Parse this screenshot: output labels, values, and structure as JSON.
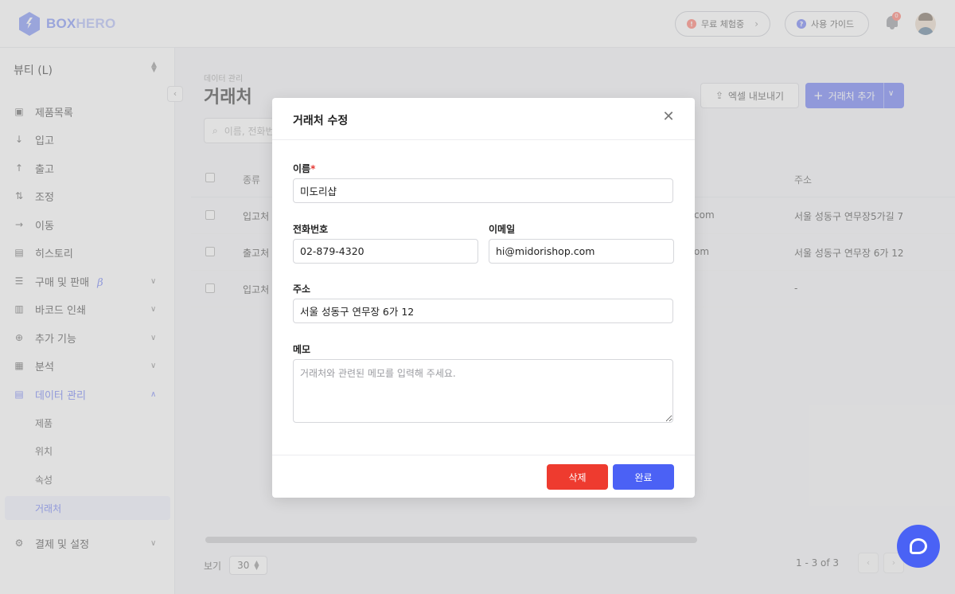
{
  "header": {
    "logo_text": "BOX",
    "logo_text_accent": "HERO",
    "trial_label": "무료 체험중",
    "trial_icon": "!",
    "guide_label": "사용 가이드",
    "guide_icon": "?",
    "notification_count": "0"
  },
  "sidebar": {
    "workspace": "뷰티 (L)",
    "items": [
      {
        "label": "제품목록",
        "icon": "box-icon"
      },
      {
        "label": "입고",
        "icon": "arrow-down-icon"
      },
      {
        "label": "출고",
        "icon": "arrow-up-icon"
      },
      {
        "label": "조정",
        "icon": "adjust-icon"
      },
      {
        "label": "이동",
        "icon": "arrow-right-icon"
      },
      {
        "label": "히스토리",
        "icon": "history-icon"
      },
      {
        "label": "구매 및 판매",
        "icon": "document-icon",
        "beta": "β"
      },
      {
        "label": "바코드 인쇄",
        "icon": "barcode-icon"
      },
      {
        "label": "추가 기능",
        "icon": "plus-circle-icon"
      },
      {
        "label": "분석",
        "icon": "chart-icon"
      },
      {
        "label": "데이터 관리",
        "icon": "database-icon"
      }
    ],
    "sub_items": [
      "제품",
      "위치",
      "속성",
      "거래처"
    ],
    "billing": "결제 및 설정"
  },
  "main": {
    "breadcrumb": "데이터 관리",
    "title": "거래처",
    "export_label": "엑셀 내보내기",
    "add_label": "거래처 추가",
    "search_placeholder": "이름, 전화번",
    "columns": {
      "type": "종류",
      "address": "주소"
    },
    "rows": [
      {
        "type": "입고처",
        "email_tail": "com",
        "address": "서울 성동구 연무장5가길 7"
      },
      {
        "type": "출고처",
        "email_tail": "om",
        "address": "서울 성동구 연무장 6가 12"
      },
      {
        "type": "입고처",
        "email_tail": "",
        "address": "-"
      }
    ],
    "view_label": "보기",
    "per_page": "30",
    "range": "1 - 3 of 3"
  },
  "modal": {
    "title": "거래처 수정",
    "name_label": "이름",
    "name_required": "*",
    "name_value": "미도리샵",
    "phone_label": "전화번호",
    "phone_value": "02-879-4320",
    "email_label": "이메일",
    "email_value": "hi@midorishop.com",
    "address_label": "주소",
    "address_value": "서울 성동구 연무장 6가 12",
    "memo_label": "메모",
    "memo_placeholder": "거래처와 관련된 메모를 입력해 주세요.",
    "delete_label": "삭제",
    "done_label": "완료"
  },
  "colors": {
    "accent": "#5b6ef5",
    "danger": "#ee3b2f",
    "help": "#4a62f5"
  }
}
